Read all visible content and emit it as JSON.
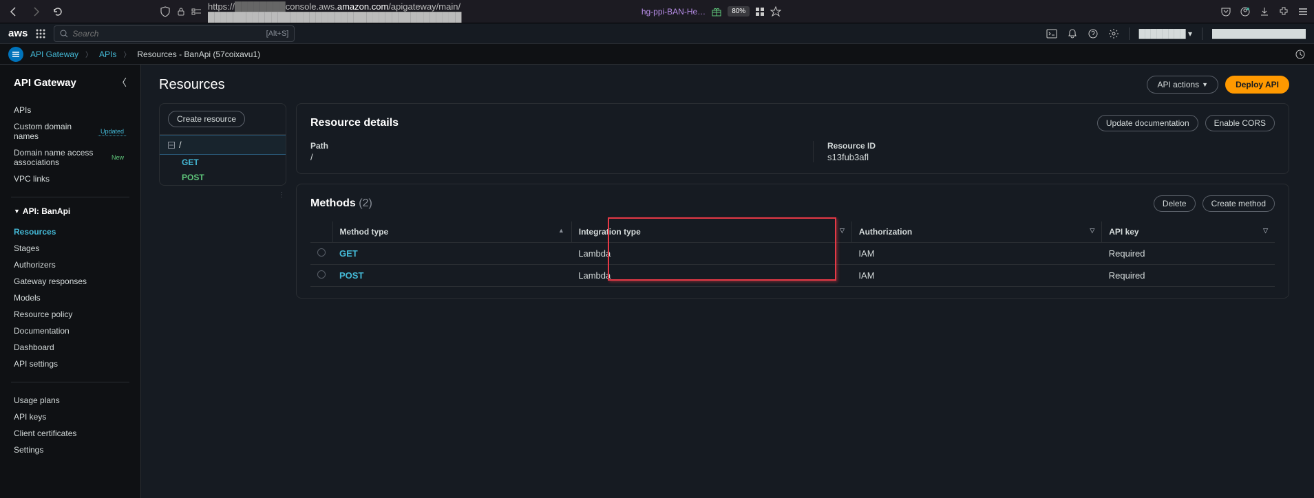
{
  "browser": {
    "url_prefix": "https://",
    "url_mid_blur": "████████",
    "url_host": "console.aws.",
    "url_domain": "amazon.com",
    "url_path": "/apigateway/main/████████████████████████████████████████",
    "hg_text": "hg-ppi-BAN-He…",
    "zoom": "80%"
  },
  "aws_nav": {
    "logo": "aws",
    "search_placeholder": "Search",
    "search_hint": "[Alt+S]",
    "region": "████████ ▾",
    "account": "████████████████"
  },
  "breadcrumb": {
    "items": [
      "API Gateway",
      "APIs"
    ],
    "current": "Resources - BanApi (57coixavu1)"
  },
  "sidebar": {
    "title": "API Gateway",
    "group1": [
      {
        "label": "APIs"
      },
      {
        "label": "Custom domain names",
        "badge": "Updated",
        "badge_class": "badge-updated"
      },
      {
        "label": "Domain name access associations",
        "badge": "New",
        "badge_class": "badge-new"
      },
      {
        "label": "VPC links"
      }
    ],
    "api_name": "API: BanApi",
    "group2": [
      {
        "label": "Resources",
        "active": true
      },
      {
        "label": "Stages"
      },
      {
        "label": "Authorizers"
      },
      {
        "label": "Gateway responses"
      },
      {
        "label": "Models"
      },
      {
        "label": "Resource policy"
      },
      {
        "label": "Documentation"
      },
      {
        "label": "Dashboard"
      },
      {
        "label": "API settings"
      }
    ],
    "group3": [
      {
        "label": "Usage plans"
      },
      {
        "label": "API keys"
      },
      {
        "label": "Client certificates"
      },
      {
        "label": "Settings"
      }
    ]
  },
  "page": {
    "title": "Resources",
    "api_actions": "API actions",
    "deploy": "Deploy API",
    "create_resource": "Create resource",
    "tree_root": "/",
    "tree_methods": [
      "GET",
      "POST"
    ]
  },
  "resource_details": {
    "title": "Resource details",
    "update_doc": "Update documentation",
    "enable_cors": "Enable CORS",
    "path_label": "Path",
    "path_value": "/",
    "id_label": "Resource ID",
    "id_value": "s13fub3afl"
  },
  "methods": {
    "title": "Methods",
    "count": "(2)",
    "delete": "Delete",
    "create": "Create method",
    "columns": {
      "method_type": "Method type",
      "integration_type": "Integration type",
      "authorization": "Authorization",
      "api_key": "API key"
    },
    "rows": [
      {
        "method": "GET",
        "integration": "Lambda",
        "auth": "IAM",
        "apikey": "Required"
      },
      {
        "method": "POST",
        "integration": "Lambda",
        "auth": "IAM",
        "apikey": "Required"
      }
    ]
  }
}
